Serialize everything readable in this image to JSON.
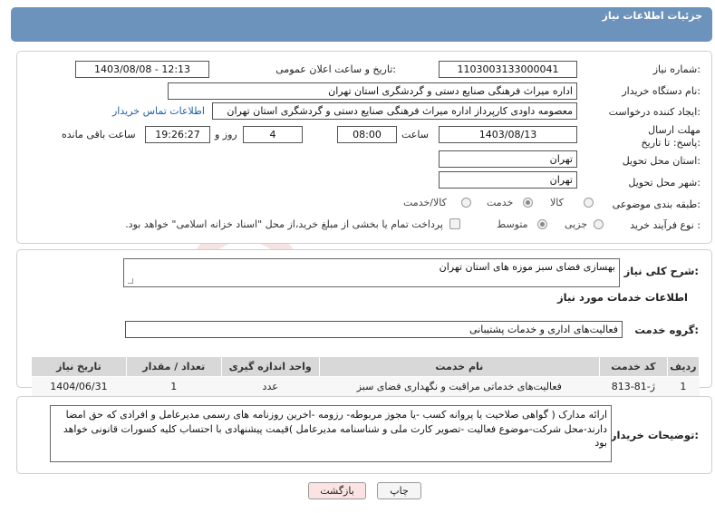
{
  "header": {
    "title": "جزئیات اطلاعات نیاز"
  },
  "form": {
    "need_number": {
      "label": "شماره نیاز:",
      "value": "1103003133000041"
    },
    "announce_datetime": {
      "label": "تاریخ و ساعت اعلان عمومی:",
      "value": "1403/08/08 - 12:13"
    },
    "buyer_org": {
      "label": "نام دستگاه خریدار:",
      "value": "اداره میراث فرهنگی  صنایع دستی و گردشگری استان تهران"
    },
    "requester": {
      "label": "ایجاد کننده درخواست:",
      "value": "معصومه داودی کارپرداز اداره میراث فرهنگی  صنایع دستی و گردشگری استان تهران",
      "contact_link": "اطلاعات تماس خریدار"
    },
    "deadline": {
      "label": "مهلت ارسال پاسخ: تا تاریخ:",
      "date": "1403/08/13",
      "time_label": "ساعت",
      "time": "08:00",
      "days": "4",
      "days_label": "روز و",
      "remaining": "19:26:27",
      "remaining_label": "ساعت باقی مانده"
    },
    "delivery_province": {
      "label": "استان محل تحویل:",
      "value": "تهران"
    },
    "delivery_city": {
      "label": "شهر محل تحویل:",
      "value": "تهران"
    },
    "category": {
      "label": "طبقه بندی موضوعی:",
      "options": [
        "کالا",
        "خدمت",
        "کالا/خدمت"
      ],
      "selected": "خدمت"
    },
    "purchase_type": {
      "label": "نوع فرآیند خرید :",
      "options": [
        "جزیی",
        "متوسط"
      ],
      "selected": "متوسط",
      "payment_note": "پرداخت تمام یا بخشی از مبلغ خرید،از محل \"اسناد خزانه اسلامی\" خواهد بود."
    }
  },
  "summary": {
    "label": "شرح کلی نیاز:",
    "value": "بهسازی فضای سبز موزه های استان تهران",
    "services_title": "اطلاعات خدمات مورد نیاز",
    "group_label": "گروه خدمت:",
    "group_value": "فعالیت‌های اداری و خدمات پشتیبانی"
  },
  "table": {
    "headers": [
      "ردیف",
      "کد خدمت",
      "نام خدمت",
      "واحد اندازه گیری",
      "تعداد / مقدار",
      "تاریخ نیاز"
    ],
    "rows": [
      [
        "1",
        "ژ-81-813",
        "فعالیت‌های خدماتی مراقبت و نگهداری فضای سبز",
        "عدد",
        "1",
        "1404/06/31"
      ]
    ]
  },
  "buyer_notes": {
    "label": "توضیحات خریدار:",
    "value": "ارائه مدارک ( گواهی صلاحیت یا پروانه کسب -یا مجوز مربوطه- رزومه -اخرین روزنامه های رسمی مدیرعامل و افرادی که حق امضا دارند-محل شرکت-موضوع فعالیت -تصویر کارت ملی و شناسنامه مدیرعامل )قیمت پیشنهادی با احتساب کلیه کسورات قانونی خواهد بود"
  },
  "buttons": {
    "print": "چاپ",
    "back": "بازگشت"
  },
  "watermark": {
    "text": "AriaTender.net"
  },
  "colors": {
    "header": "#6b93bb",
    "link": "#1f5fa8",
    "back_button": "#fbe3e3",
    "table_header": "#d8d8d8"
  }
}
